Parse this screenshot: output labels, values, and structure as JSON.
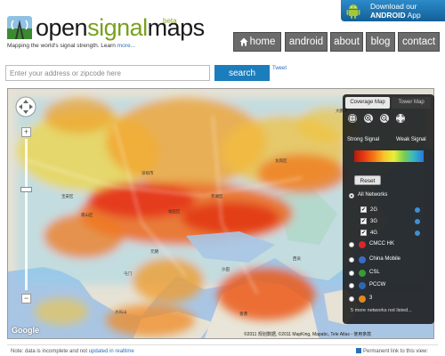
{
  "brand": {
    "name_part1": "open",
    "name_part2": "signal",
    "name_part3": "maps",
    "beta": "beta",
    "tagline": "Mapping the world's signal strength. Learn",
    "tagline_link": "more..."
  },
  "android_banner": {
    "line1": "Download our",
    "line2_bold": "ANDROID",
    "line2_rest": "App"
  },
  "nav": {
    "home": "home",
    "android": "android",
    "about": "about",
    "blog": "blog",
    "contact": "contact"
  },
  "search": {
    "placeholder": "Enter your address or zipcode here",
    "value": "",
    "button": "search",
    "tweet": "Tweet"
  },
  "map": {
    "labels": [
      "大鹏湾",
      "宝安区",
      "深圳市",
      "罗湖区",
      "福田区",
      "南山区",
      "龙岗区",
      "元朗",
      "屯门",
      "沙田",
      "西贡",
      "大屿山",
      "香港"
    ],
    "copyright": "©2011 规划数据, ©2011 MapKing, Mapabc, Tele Atlas - 使用条款",
    "google": "Google"
  },
  "panel": {
    "tab_coverage": "Coverage Map",
    "tab_tower": "Tower Map",
    "legend_strong": "Strong Signal",
    "legend_weak": "Weak Signal",
    "reset": "Reset",
    "all_networks": "All Networks",
    "types": [
      "2G",
      "3G",
      "4G"
    ],
    "operators": [
      {
        "name": "CMCC HK",
        "color": "#d9262c"
      },
      {
        "name": "China Mobile",
        "color": "#3a6bc8"
      },
      {
        "name": "CSL",
        "color": "#3a9a37"
      },
      {
        "name": "PCCW",
        "color": "#2f67b2"
      },
      {
        "name": "3",
        "color": "#e08a1e"
      }
    ],
    "more": "5 more networks not listed..."
  },
  "footer": {
    "note": "Note: data is incomplete and not",
    "note_link": "updated in realtime",
    "permalink": "Permanent link to this view:"
  }
}
